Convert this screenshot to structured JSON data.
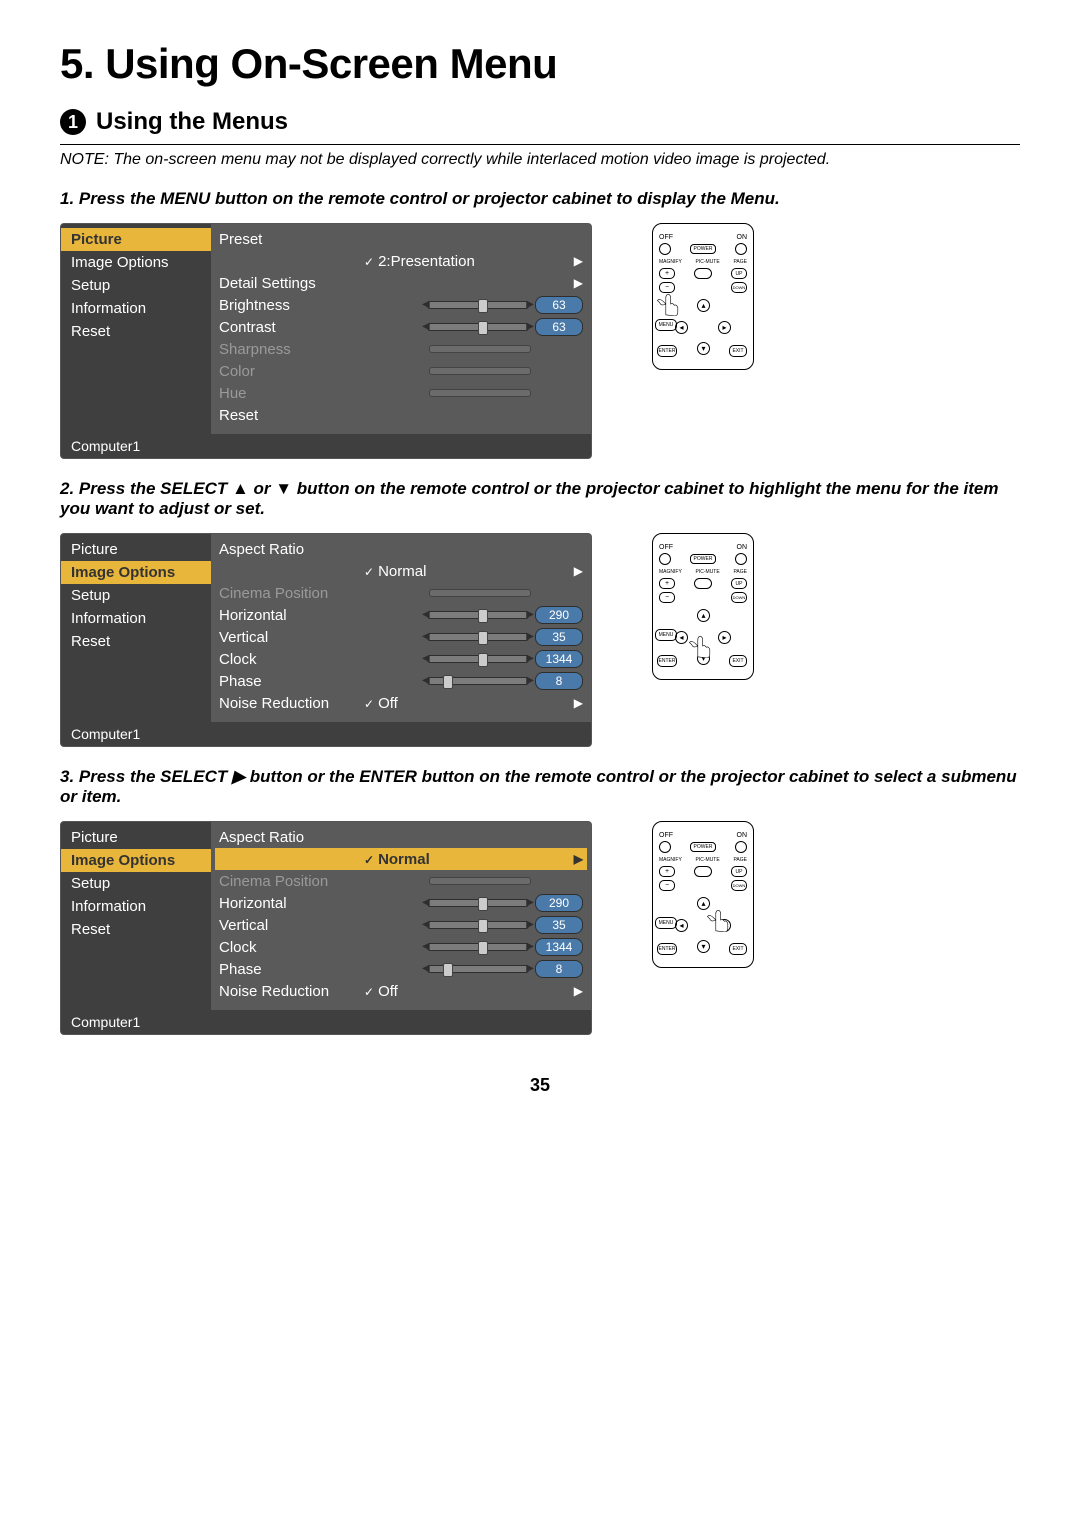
{
  "chapter_title": "5. Using On-Screen Menu",
  "section_number": "1",
  "section_title": "Using the Menus",
  "note": "NOTE: The on-screen menu may not be displayed correctly while interlaced motion video image is projected.",
  "page_number": "35",
  "steps": [
    {
      "text": "1.  Press the MENU button on the remote control or projector cabinet to display the Menu."
    },
    {
      "text": "2.  Press the SELECT ▲ or ▼ button on the remote control or the projector cabinet to highlight the menu for the item you want to adjust or set."
    },
    {
      "text": "3.  Press the SELECT ▶ button or the ENTER button on the remote control or the projector cabinet to select a submenu or item."
    }
  ],
  "osd1": {
    "nav": [
      "Picture",
      "Image Options",
      "Setup",
      "Information",
      "Reset"
    ],
    "nav_selected": 0,
    "rows": [
      {
        "label": "Preset",
        "kind": "blank"
      },
      {
        "label": "",
        "kind": "check",
        "value": "2:Presentation",
        "arrow": true
      },
      {
        "label": "Detail Settings",
        "kind": "right",
        "arrow": true
      },
      {
        "label": "Brightness",
        "kind": "slider",
        "pos": 50,
        "pill": "63"
      },
      {
        "label": "Contrast",
        "kind": "slider",
        "pos": 50,
        "pill": "63"
      },
      {
        "label": "Sharpness",
        "kind": "slider",
        "dim": true
      },
      {
        "label": "Color",
        "kind": "slider",
        "dim": true
      },
      {
        "label": "Hue",
        "kind": "slider",
        "dim": true
      },
      {
        "label": "Reset",
        "kind": "blank"
      }
    ],
    "footer": "Computer1"
  },
  "osd2": {
    "nav": [
      "Picture",
      "Image Options",
      "Setup",
      "Information",
      "Reset"
    ],
    "nav_selected": 1,
    "rows": [
      {
        "label": "Aspect Ratio",
        "kind": "blank"
      },
      {
        "label": "",
        "kind": "check",
        "value": "Normal",
        "arrow": true
      },
      {
        "label": "Cinema Position",
        "kind": "slider",
        "dim": true
      },
      {
        "label": "Horizontal",
        "kind": "slider",
        "pos": 50,
        "pill": "290"
      },
      {
        "label": "Vertical",
        "kind": "slider",
        "pos": 50,
        "pill": "35"
      },
      {
        "label": "Clock",
        "kind": "slider",
        "pos": 50,
        "pill": "1344"
      },
      {
        "label": "Phase",
        "kind": "slider",
        "pos": 15,
        "pill": "8"
      },
      {
        "label": "Noise Reduction",
        "kind": "check",
        "value": "Off",
        "arrow": true
      }
    ],
    "footer": "Computer1"
  },
  "osd3": {
    "nav": [
      "Picture",
      "Image Options",
      "Setup",
      "Information",
      "Reset"
    ],
    "nav_selected": 1,
    "rows": [
      {
        "label": "Aspect Ratio",
        "kind": "blank"
      },
      {
        "label": "",
        "kind": "check",
        "value": "Normal",
        "arrow": true,
        "highlight": true
      },
      {
        "label": "Cinema Position",
        "kind": "slider",
        "dim": true
      },
      {
        "label": "Horizontal",
        "kind": "slider",
        "pos": 50,
        "pill": "290"
      },
      {
        "label": "Vertical",
        "kind": "slider",
        "pos": 50,
        "pill": "35"
      },
      {
        "label": "Clock",
        "kind": "slider",
        "pos": 50,
        "pill": "1344"
      },
      {
        "label": "Phase",
        "kind": "slider",
        "pos": 15,
        "pill": "8"
      },
      {
        "label": "Noise Reduction",
        "kind": "check",
        "value": "Off",
        "arrow": true
      }
    ],
    "footer": "Computer1"
  },
  "remote": {
    "off": "OFF",
    "on": "ON",
    "power": "POWER",
    "magnify": "MAGNIFY",
    "picmute": "PIC-MUTE",
    "page": "PAGE",
    "plus": "+",
    "minus": "−",
    "down_lbl": "DOWN",
    "menu": "MENU",
    "enter": "ENTER",
    "exit": "EXIT"
  }
}
